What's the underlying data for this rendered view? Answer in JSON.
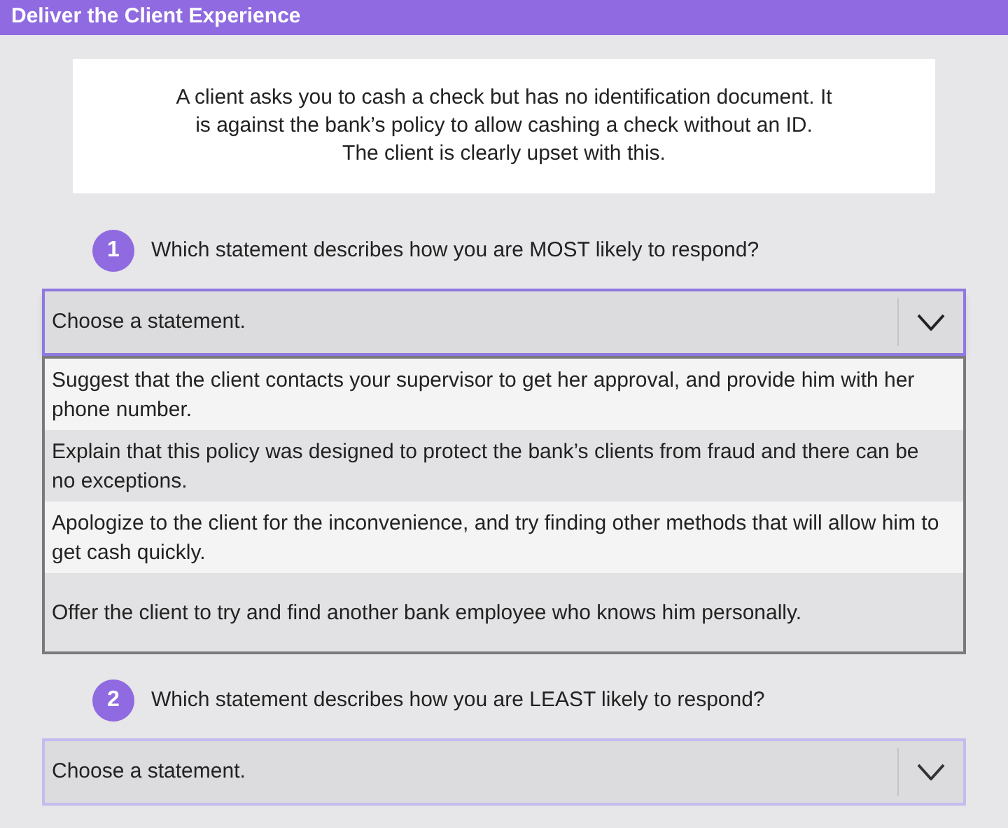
{
  "header": {
    "title": "Deliver the Client Experience"
  },
  "scenario": "A client asks you to cash a check but has no identification document. It is against the bank’s policy to allow cashing a check without an ID. The client is clearly upset with this.",
  "questions": [
    {
      "number": "1",
      "text": "Which statement describes how you are MOST likely to respond?",
      "dropdown": {
        "placeholder": "Choose a statement.",
        "expanded": true,
        "options": [
          "Suggest that the client contacts your supervisor to get her approval, and provide him with her phone number.",
          "Explain that this policy was designed to protect the bank’s clients from fraud and there can be no exceptions.",
          "Apologize to the client for the inconvenience, and try finding other methods that will allow him to get cash quickly.",
          "Offer the client to try and find another bank employee who knows him personally."
        ]
      }
    },
    {
      "number": "2",
      "text": "Which statement describes how you are LEAST likely to respond?",
      "dropdown": {
        "placeholder": "Choose a statement.",
        "expanded": false
      }
    }
  ]
}
